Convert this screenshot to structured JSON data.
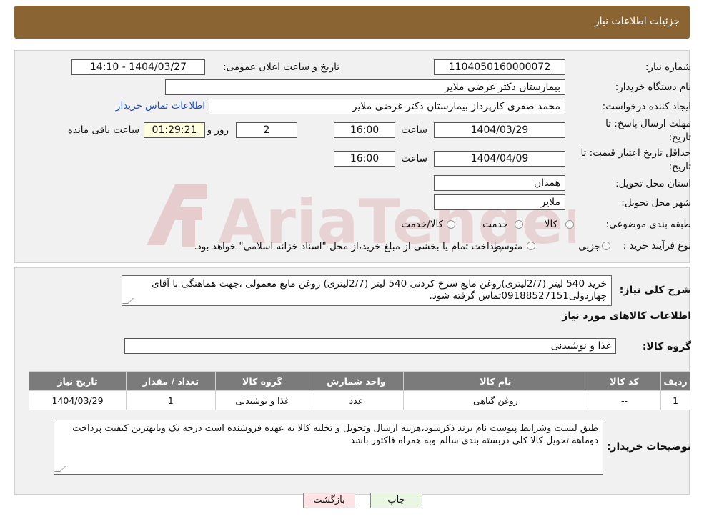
{
  "header": {
    "title": "جزئیات اطلاعات نیاز"
  },
  "form": {
    "need_number_label": "شماره نیاز:",
    "need_number": "1104050160000072",
    "announce_label": "تاریخ و ساعت اعلان عمومی:",
    "announce_value": "1404/03/27 - 14:10",
    "buyer_org_label": "نام دستگاه خریدار:",
    "buyer_org": "بیمارستان دکتر غرضی ملایر",
    "creator_label": "ایجاد کننده درخواست:",
    "creator": "محمد صفری کارپرداز بیمارستان دکتر غرضی ملایر",
    "contact_link": "اطلاعات تماس خریدار",
    "reply_deadline_label_1": "مهلت ارسال پاسخ: تا",
    "reply_deadline_label_2": "تاریخ:",
    "reply_date": "1404/03/29",
    "time_label": "ساعت",
    "reply_time": "16:00",
    "days_value": "2",
    "days_label": "روز و",
    "remaining_time": "01:29:21",
    "remaining_label": "ساعت باقی مانده",
    "price_validity_label_1": "حداقل تاریخ اعتبار قیمت: تا",
    "price_validity_label_2": "تاریخ:",
    "validity_date": "1404/04/09",
    "validity_time": "16:00",
    "province_label": "استان محل تحویل:",
    "province": "همدان",
    "city_label": "شهر محل تحویل:",
    "city": "ملایر",
    "category_label": "طبقه بندی موضوعی:",
    "category_options": [
      "کالا",
      "خدمت",
      "کالا/خدمت"
    ],
    "purchase_type_label": "نوع فرآیند خرید :",
    "purchase_options": [
      "جزیی",
      "متوسط"
    ],
    "purchase_note": "پرداخت تمام یا بخشی از مبلغ خرید،از محل \"اسناد خزانه اسلامی\" خواهد بود."
  },
  "description": {
    "label": "شرح کلی نیاز:",
    "text": "خرید 540 لیتر (2/7لیتری)روغن مایع سرخ کردنی  540 لیتر (2/7لیتری) روغن مایع معمولی ،جهت هماهنگی با آقای چهاردولی09188527151تماس گرفته شود."
  },
  "goods": {
    "section_title": "اطلاعات کالاهای مورد نیاز",
    "group_label": "گروه کالا:",
    "group_value": "غذا و نوشیدنی",
    "columns": [
      "ردیف",
      "کد کالا",
      "نام کالا",
      "واحد شمارش",
      "گروه کالا",
      "تعداد / مقدار",
      "تاریخ نیاز"
    ],
    "rows": [
      [
        "1",
        "--",
        "روغن گیاهی",
        "عدد",
        "غذا و نوشیدنی",
        "1",
        "1404/03/29"
      ]
    ]
  },
  "buyer_notes": {
    "label": "توضیحات خریدار:",
    "text": "طبق لیست وشرایط پیوست نام برند ذکرشود،هزینه ارسال وتحویل و تخلیه کالا به عهده فروشنده است درجه یک وبابهترین کیفیت پرداخت دوماهه تحویل کالا کلی دربسته بندی سالم وبه همراه فاکتور باشد"
  },
  "buttons": {
    "print": "چاپ",
    "back": "بازگشت"
  },
  "watermark": {
    "text": "AriaTender.neT"
  },
  "colors": {
    "header": "#8a6533",
    "table_header": "#7b7b7b",
    "back_button": "#fde3e3",
    "print_button": "#e8f6e2",
    "link": "#1f4fc4"
  }
}
